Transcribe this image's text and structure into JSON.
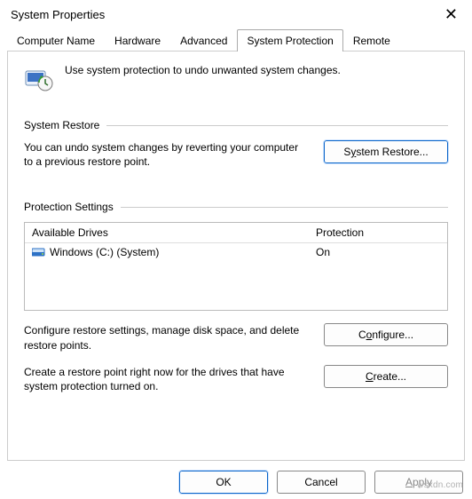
{
  "window": {
    "title": "System Properties",
    "close_label": "✕"
  },
  "tabs": [
    {
      "label": "Computer Name"
    },
    {
      "label": "Hardware"
    },
    {
      "label": "Advanced"
    },
    {
      "label": "System Protection",
      "active": true
    },
    {
      "label": "Remote"
    }
  ],
  "intro": {
    "text": "Use system protection to undo unwanted system changes."
  },
  "restore": {
    "heading": "System Restore",
    "text": "You can undo system changes by reverting your computer to a previous restore point.",
    "button_prefix": "S",
    "button_u": "y",
    "button_suffix": "stem Restore..."
  },
  "protection": {
    "heading": "Protection Settings",
    "cols": {
      "drive": "Available Drives",
      "prot": "Protection"
    },
    "rows": [
      {
        "name": "Windows (C:) (System)",
        "status": "On"
      }
    ],
    "configure_text": "Configure restore settings, manage disk space, and delete restore points.",
    "configure_prefix": "C",
    "configure_u": "o",
    "configure_suffix": "nfigure...",
    "create_text": "Create a restore point right now for the drives that have system protection turned on.",
    "create_prefix": "",
    "create_u": "C",
    "create_suffix": "reate..."
  },
  "buttons": {
    "ok": "OK",
    "cancel": "Cancel",
    "apply_prefix": "",
    "apply_u": "A",
    "apply_suffix": "pply"
  },
  "watermark": "wsxdn.com"
}
